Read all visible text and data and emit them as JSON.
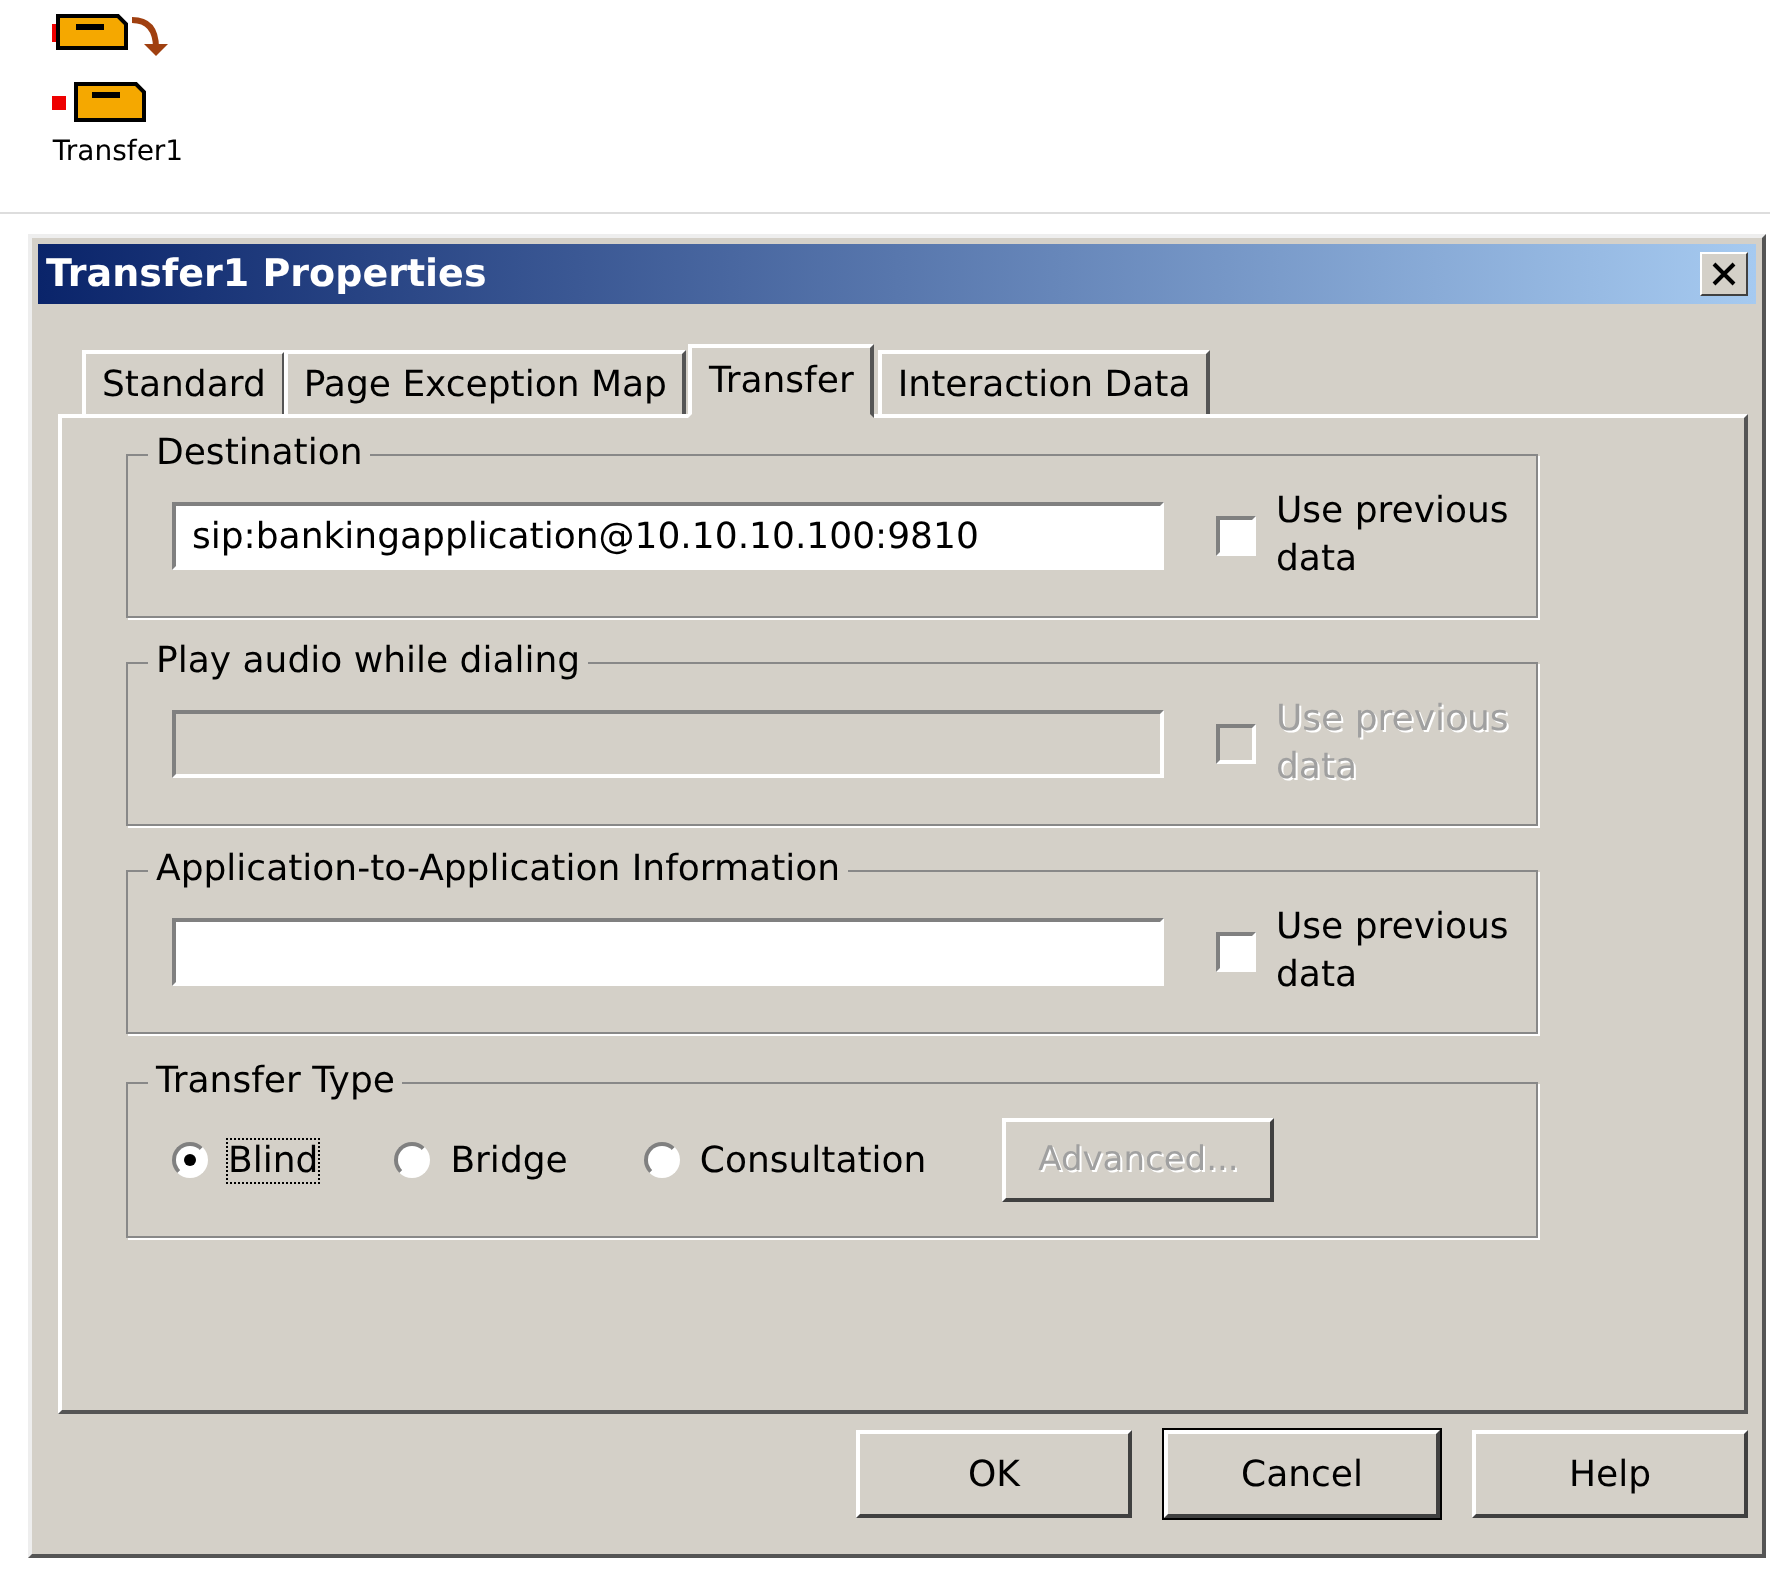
{
  "canvas_item": {
    "label": "Transfer1"
  },
  "dialog": {
    "title": "Transfer1 Properties",
    "tabs": [
      {
        "label": "Standard",
        "selected": false
      },
      {
        "label": "Page Exception Map",
        "selected": false
      },
      {
        "label": "Transfer",
        "selected": true
      },
      {
        "label": "Interaction Data",
        "selected": false
      }
    ],
    "groups": [
      {
        "kind": "field",
        "title": "Destination",
        "value": "sip:bankingapplication@10.10.10.100:9810",
        "disabled": false,
        "checkbox": {
          "label": "Use previous data",
          "checked": false
        }
      },
      {
        "kind": "field",
        "title": "Play audio while dialing",
        "disabled": true,
        "checkbox": {
          "label": "Use previous data",
          "checked": false
        }
      },
      {
        "kind": "field",
        "title": "Application-to-Application Information",
        "disabled": false,
        "checkbox": {
          "label": "Use previous data",
          "checked": false
        }
      },
      {
        "kind": "radios",
        "title": "Transfer Type",
        "options": [
          {
            "label": "Blind",
            "selected": true
          },
          {
            "label": "Bridge",
            "selected": false
          },
          {
            "label": "Consultation",
            "selected": false
          }
        ],
        "button": {
          "label": "Advanced...",
          "disabled": true
        }
      }
    ],
    "buttons": [
      {
        "label": "OK",
        "default": false
      },
      {
        "label": "Cancel",
        "default": true
      },
      {
        "label": "Help",
        "default": false
      }
    ]
  }
}
